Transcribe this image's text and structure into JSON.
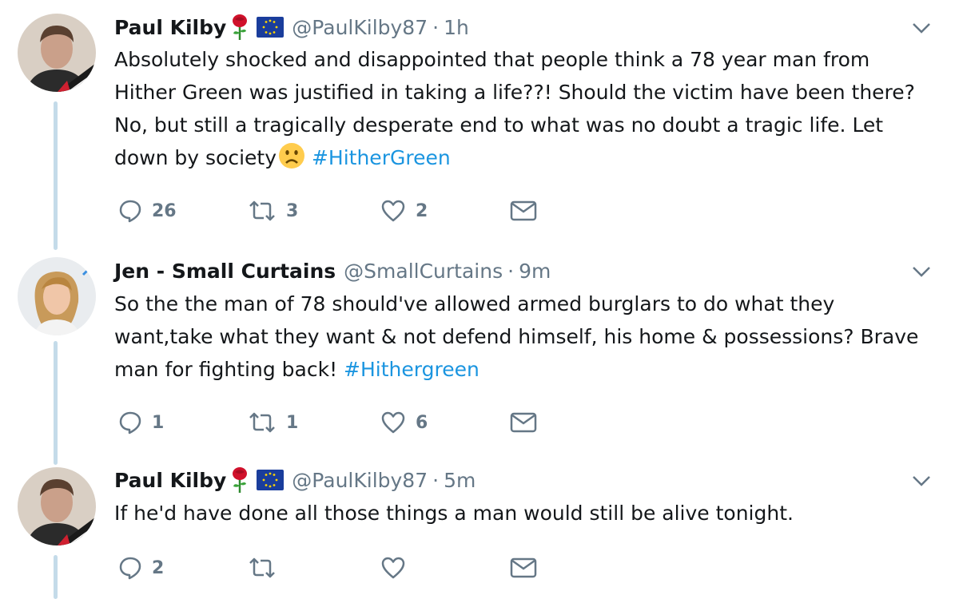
{
  "tweets": [
    {
      "name": "Paul Kilby",
      "handle": "@PaulKilby87",
      "separator": "·",
      "time": "1h",
      "text_before": "Absolutely shocked and disappointed that people think a 78 year man from Hither Green was justified in taking a life??! Should the victim have been there? No, but still a tragically desperate end to what was no doubt a tragic life. Let down by society",
      "emoji": "frowning-face-emoji",
      "hashtag": "#HitherGreen",
      "replies": "26",
      "retweets": "3",
      "likes": "2"
    },
    {
      "name": "Jen - Small Curtains",
      "handle": "@SmallCurtains",
      "separator": "·",
      "time": "9m",
      "text_before": "So the the man of 78 should've allowed armed burglars to do what they want,take what they want  & not defend himself, his home & possessions? Brave man for fighting back!",
      "hashtag": "#Hithergreen",
      "replies": "1",
      "retweets": "1",
      "likes": "6"
    },
    {
      "name": "Paul Kilby",
      "handle": "@PaulKilby87",
      "separator": "·",
      "time": "5m",
      "text_before": "If he'd have done all those things a man would still be alive tonight.",
      "replies": "2",
      "retweets": "",
      "likes": ""
    }
  ],
  "colors": {
    "link": "#1b95e0",
    "secondary_text": "#657786",
    "thread_line": "#c4dbe9",
    "primary_text": "#14171a"
  },
  "icons": [
    "reply-icon",
    "retweet-icon",
    "like-icon",
    "direct-message-icon",
    "chevron-down-icon",
    "rose-emoji",
    "eu-flag-emoji"
  ]
}
